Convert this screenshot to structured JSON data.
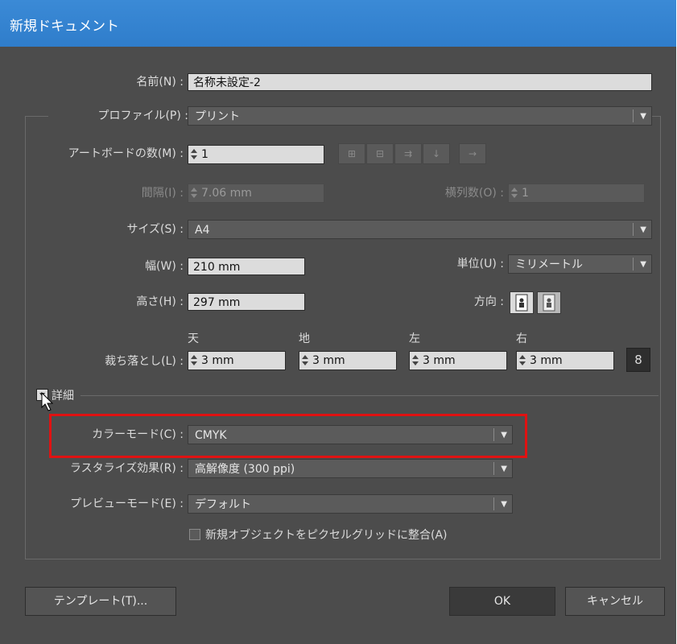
{
  "window": {
    "title": "新規ドキュメント"
  },
  "name": {
    "label": "名前(N) :",
    "value": "名称未設定-2"
  },
  "profile": {
    "label": "プロファイル(P) :",
    "value": "プリント"
  },
  "artboards": {
    "label": "アートボードの数(M) :",
    "value": "1"
  },
  "spacing": {
    "label": "間隔(I) :",
    "value": "7.06 mm"
  },
  "columns": {
    "label": "横列数(O) :",
    "value": "1"
  },
  "size": {
    "label": "サイズ(S) :",
    "value": "A4"
  },
  "width": {
    "label": "幅(W) :",
    "value": "210 mm"
  },
  "height": {
    "label": "高さ(H) :",
    "value": "297 mm"
  },
  "units": {
    "label": "単位(U) :",
    "value": "ミリメートル"
  },
  "orientation": {
    "label": "方向 :"
  },
  "bleed": {
    "label": "裁ち落とし(L) :",
    "top_label": "天",
    "bottom_label": "地",
    "left_label": "左",
    "right_label": "右",
    "top": "3 mm",
    "bottom": "3 mm",
    "left": "3 mm",
    "right": "3 mm"
  },
  "advanced": {
    "label": "詳細"
  },
  "color_mode": {
    "label": "カラーモード(C) :",
    "value": "CMYK"
  },
  "raster": {
    "label": "ラスタライズ効果(R) :",
    "value": "高解像度 (300 ppi)"
  },
  "preview": {
    "label": "プレビューモード(E) :",
    "value": "デフォルト"
  },
  "pixel_grid": {
    "label": "新規オブジェクトをピクセルグリッドに整合(A)",
    "checked": false
  },
  "buttons": {
    "templates": "テンプレート(T)...",
    "ok": "OK",
    "cancel": "キャンセル"
  },
  "colors": {
    "accent": "#2f7dcb",
    "highlight": "#e01212",
    "background": "#4c4c4c"
  }
}
